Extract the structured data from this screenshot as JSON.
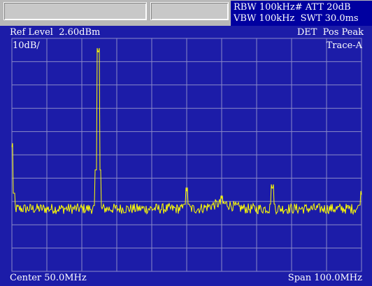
{
  "top_boxes": [
    "",
    ""
  ],
  "settings": {
    "rbw_line": "RBW 100kHz# ATT 20dB",
    "vbw_line": "VBW 100kHz  SWT 30.0ms"
  },
  "display": {
    "ref_level": "Ref Level  2.60dBm",
    "scale": "10dB/",
    "detector": "DET  Pos Peak",
    "trace": "Trace-A",
    "center": "Center 50.0MHz",
    "span": "Span 100.0MHz"
  },
  "colors": {
    "background": "#1c1ca8",
    "grid": "#8a8ac8",
    "trace": "#ffff00",
    "text": "#ffffff",
    "settings_bg": "#0000a0"
  },
  "chart_data": {
    "type": "line",
    "x_unit": "MHz",
    "y_unit": "dBm",
    "xlim": [
      0,
      100
    ],
    "ylim": [
      -97.4,
      2.6
    ],
    "x_divisions": 10,
    "y_divisions": 10,
    "grid": true,
    "noise_floor_dbm": -70.5,
    "peaks": [
      {
        "x": 0.0,
        "y": -44.0
      },
      {
        "x": 24.7,
        "y": -4.0
      },
      {
        "x": 50.0,
        "y": -63.0
      },
      {
        "x": 60.0,
        "y": -66.5
      },
      {
        "x": 74.5,
        "y": -62.5
      },
      {
        "x": 100.0,
        "y": -64.5
      }
    ]
  }
}
